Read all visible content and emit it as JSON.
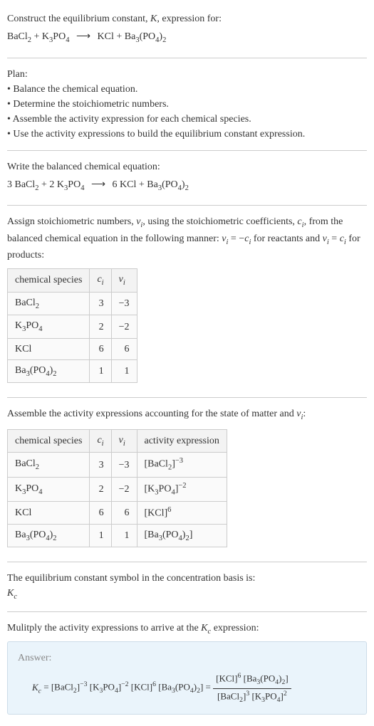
{
  "intro": {
    "line1_prefix": "Construct the equilibrium constant, ",
    "K": "K",
    "line1_suffix": ", expression for:"
  },
  "plan": {
    "heading": "Plan:",
    "items": [
      "Balance the chemical equation.",
      "Determine the stoichiometric numbers.",
      "Assemble the activity expression for each chemical species.",
      "Use the activity expressions to build the equilibrium constant expression."
    ]
  },
  "balanced_heading": "Write the balanced chemical equation:",
  "stoich_text": {
    "p1": "Assign stoichiometric numbers, ",
    "nu": "ν",
    "p2": ", using the stoichiometric coefficients, ",
    "c": "c",
    "p3": ", from the balanced chemical equation in the following manner: ",
    "eq1": " = −",
    "p4": " for reactants and ",
    "eq2": " = ",
    "p5": " for products:"
  },
  "table1": {
    "headers": [
      "chemical species",
      "cᵢ",
      "νᵢ"
    ],
    "rows": [
      {
        "species": "BaCl₂",
        "c": "3",
        "nu": "−3"
      },
      {
        "species": "K₃PO₄",
        "c": "2",
        "nu": "−2"
      },
      {
        "species": "KCl",
        "c": "6",
        "nu": "6"
      },
      {
        "species": "Ba₃(PO₄)₂",
        "c": "1",
        "nu": "1"
      }
    ]
  },
  "activity_heading_p1": "Assemble the activity expressions accounting for the state of matter and ",
  "activity_heading_p2": ":",
  "table2": {
    "headers": [
      "chemical species",
      "cᵢ",
      "νᵢ",
      "activity expression"
    ],
    "rows": [
      {
        "species": "BaCl₂",
        "c": "3",
        "nu": "−3",
        "act": "[BaCl₂]⁻³"
      },
      {
        "species": "K₃PO₄",
        "c": "2",
        "nu": "−2",
        "act": "[K₃PO₄]⁻²"
      },
      {
        "species": "KCl",
        "c": "6",
        "nu": "6",
        "act": "[KCl]⁶"
      },
      {
        "species": "Ba₃(PO₄)₂",
        "c": "1",
        "nu": "1",
        "act": "[Ba₃(PO₄)₂]"
      }
    ]
  },
  "kc_symbol_text": "The equilibrium constant symbol in the concentration basis is:",
  "kc_symbol": "K",
  "kc_sub": "c",
  "multiply_text_p1": "Mulitply the activity expressions to arrive at the ",
  "multiply_text_p2": " expression:",
  "answer_label": "Answer:",
  "chart_data": {
    "type": "table",
    "equation_unbalanced": {
      "reactants": [
        {
          "species": "BaCl2",
          "coef": 1
        },
        {
          "species": "K3PO4",
          "coef": 1
        }
      ],
      "products": [
        {
          "species": "KCl",
          "coef": 1
        },
        {
          "species": "Ba3(PO4)2",
          "coef": 1
        }
      ]
    },
    "equation_balanced": {
      "reactants": [
        {
          "species": "BaCl2",
          "coef": 3
        },
        {
          "species": "K3PO4",
          "coef": 2
        }
      ],
      "products": [
        {
          "species": "KCl",
          "coef": 6
        },
        {
          "species": "Ba3(PO4)2",
          "coef": 1
        }
      ]
    },
    "stoichiometric_table": [
      {
        "species": "BaCl2",
        "c_i": 3,
        "nu_i": -3
      },
      {
        "species": "K3PO4",
        "c_i": 2,
        "nu_i": -2
      },
      {
        "species": "KCl",
        "c_i": 6,
        "nu_i": 6
      },
      {
        "species": "Ba3(PO4)2",
        "c_i": 1,
        "nu_i": 1
      }
    ],
    "activity_table": [
      {
        "species": "BaCl2",
        "c_i": 3,
        "nu_i": -3,
        "activity": "[BaCl2]^-3"
      },
      {
        "species": "K3PO4",
        "c_i": 2,
        "nu_i": -2,
        "activity": "[K3PO4]^-2"
      },
      {
        "species": "KCl",
        "c_i": 6,
        "nu_i": 6,
        "activity": "[KCl]^6"
      },
      {
        "species": "Ba3(PO4)2",
        "c_i": 1,
        "nu_i": 1,
        "activity": "[Ba3(PO4)2]"
      }
    ],
    "Kc_expression": "Kc = [BaCl2]^-3 [K3PO4]^-2 [KCl]^6 [Ba3(PO4)2] = ([KCl]^6 [Ba3(PO4)2]) / ([BaCl2]^3 [K3PO4]^2)"
  }
}
